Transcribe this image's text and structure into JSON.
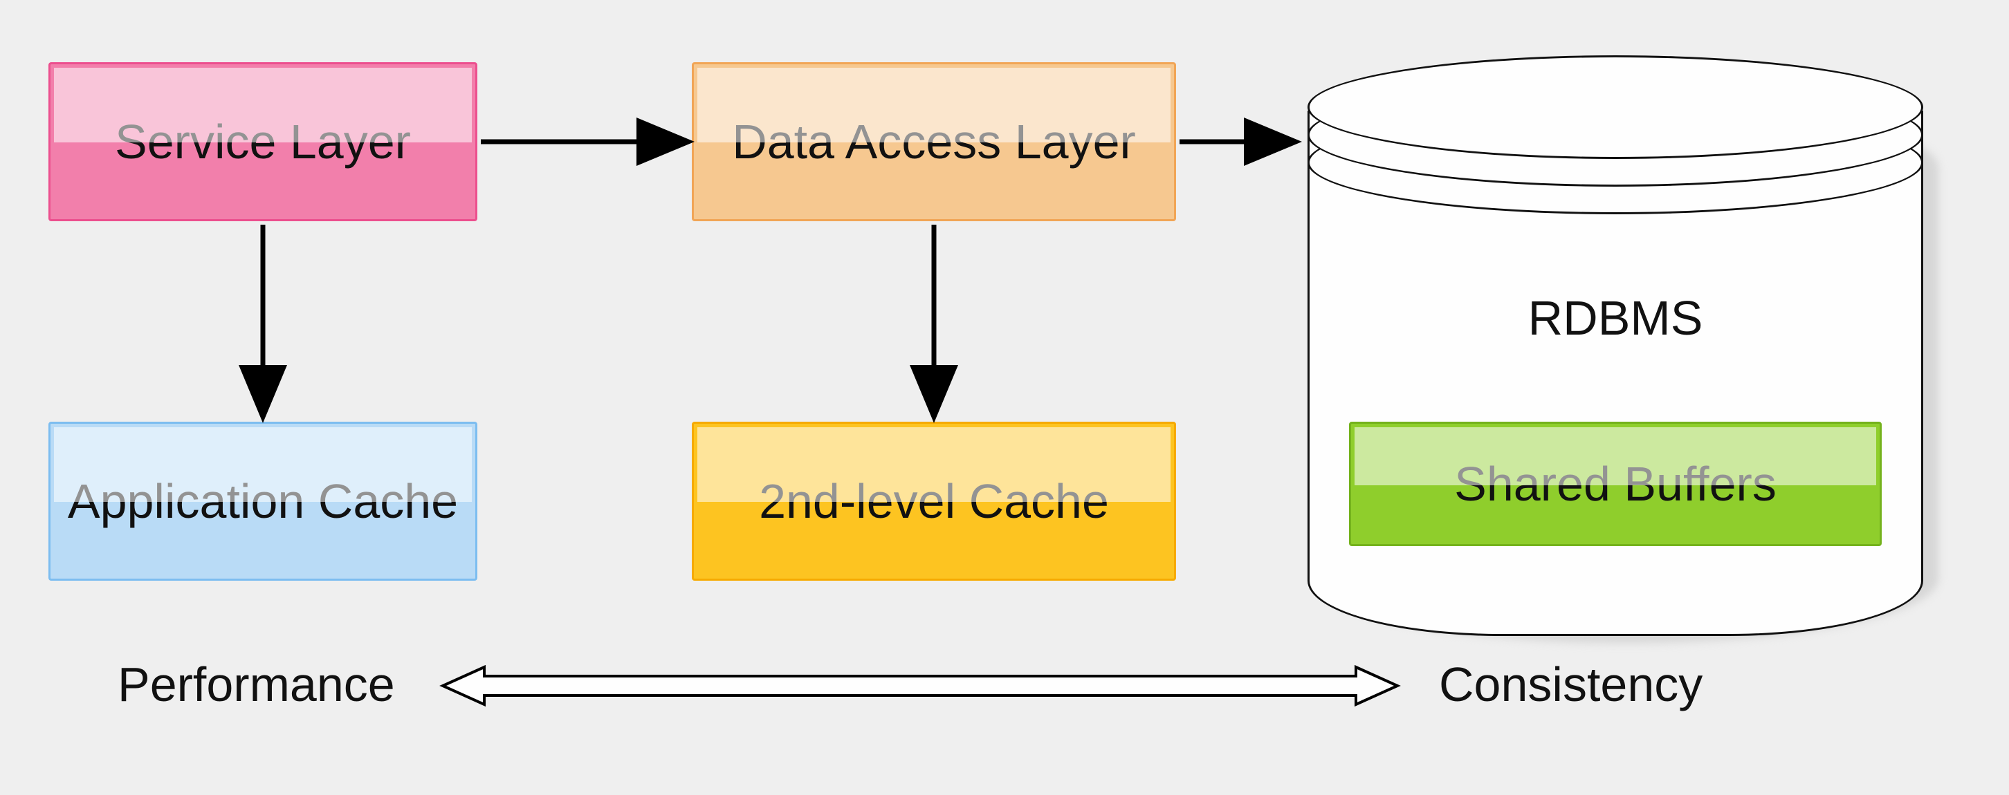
{
  "nodes": {
    "service_layer": "Service Layer",
    "data_access_layer": "Data Access Layer",
    "application_cache": "Application Cache",
    "second_level_cache": "2nd-level Cache",
    "shared_buffers": "Shared Buffers",
    "rdbms": "RDBMS"
  },
  "axis": {
    "left": "Performance",
    "right": "Consistency"
  },
  "colors": {
    "pink": "#f27fab",
    "orange": "#f6c890",
    "blue": "#b9dbf6",
    "gold": "#fdc421",
    "green": "#8fce2c",
    "bg": "#efefef"
  }
}
